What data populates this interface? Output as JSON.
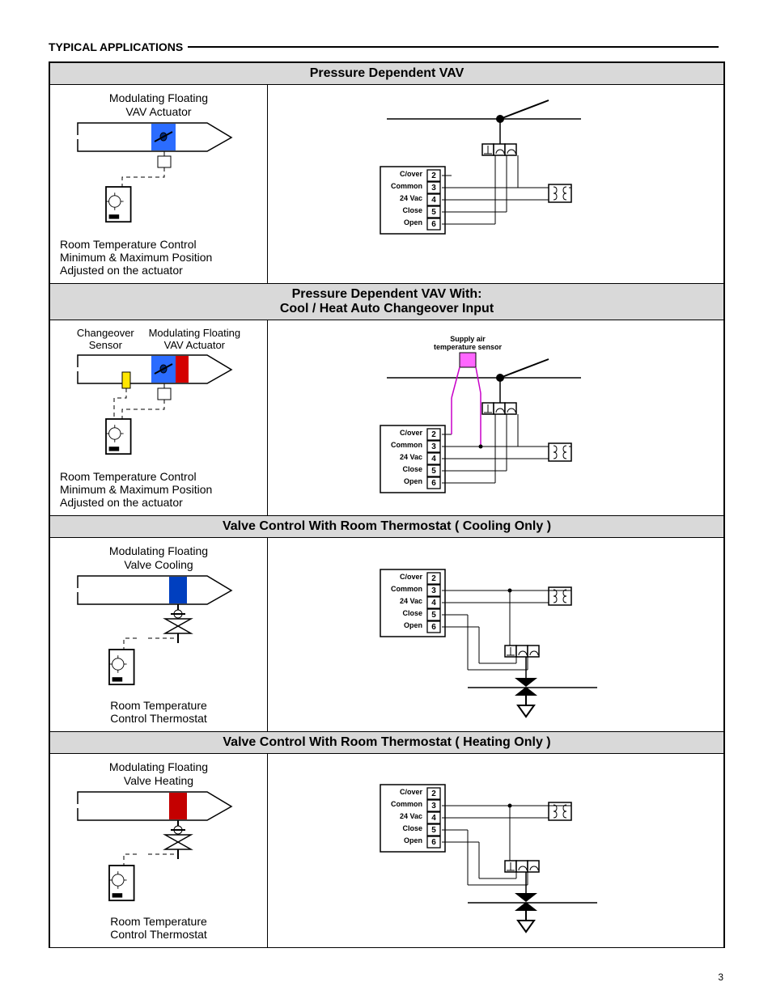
{
  "section_header": "TYPICAL APPLICATIONS",
  "page_number": "3",
  "terminals": {
    "rows": [
      {
        "label": "C/over",
        "num": "2"
      },
      {
        "label": "Common",
        "num": "3"
      },
      {
        "label": "24 Vac",
        "num": "4"
      },
      {
        "label": "Close",
        "num": "5"
      },
      {
        "label": "Open",
        "num": "6"
      }
    ]
  },
  "sat_label": "Supply air\ntemperature sensor",
  "apps": [
    {
      "title_lines": [
        "Pressure Dependent VAV"
      ],
      "left_top": "Modulating Floating\nVAV Actuator",
      "left_bottom": "Room Temperature Control\nMinimum & Maximum Position\nAdjusted on the actuator",
      "pictogram": "vav",
      "schematic": "vav"
    },
    {
      "title_lines": [
        "Pressure Dependent VAV With:",
        "Cool / Heat Auto Changeover Input"
      ],
      "left_top": "",
      "left_split_labels": [
        "Changeover\nSensor",
        "Modulating Floating\nVAV Actuator"
      ],
      "left_bottom": "Room Temperature Control\nMinimum & Maximum Position\nAdjusted on the actuator",
      "pictogram": "vav_co",
      "schematic": "vav_co"
    },
    {
      "title_lines": [
        "Valve Control With Room Thermostat ( Cooling Only )"
      ],
      "left_top": "Modulating Floating\nValve Cooling",
      "left_bottom": "Room Temperature\nControl Thermostat",
      "pictogram": "valve_cool",
      "schematic": "valve"
    },
    {
      "title_lines": [
        "Valve Control With Room Thermostat ( Heating Only )"
      ],
      "left_top": "Modulating Floating\nValve Heating",
      "left_bottom": "Room Temperature\nControl Thermostat",
      "pictogram": "valve_heat",
      "schematic": "valve"
    }
  ]
}
